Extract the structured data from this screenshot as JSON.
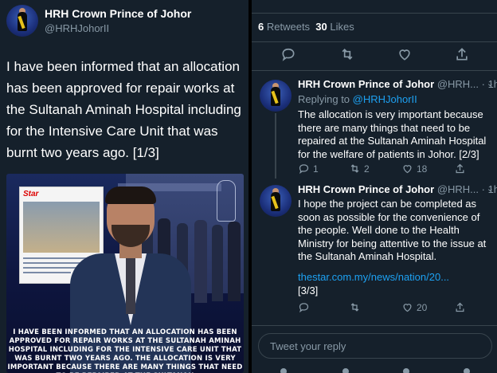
{
  "left": {
    "author_name": "HRH Crown Prince of Johor",
    "author_handle": "@HRHJohorII",
    "tweet_text": "I have been informed that an allocation has been approved for repair works at the Sultanah Aminah Hospital including for the Intensive Care Unit that was burnt two years ago. [1/3]",
    "image_caption": "I HAVE BEEN INFORMED THAT AN ALLOCATION HAS BEEN APPROVED FOR REPAIR WORKS AT THE SULTANAH AMINAH HOSPITAL INCLUDING FOR THE INTENSIVE CARE UNIT THAT WAS BURNT TWO YEARS AGO. THE ALLOCATION IS VERY IMPORTANT BECAUSE THERE ARE MANY THINGS THAT NEED TO BE REPAIRED AT THE SULTANAH",
    "news_logo": "Star"
  },
  "right": {
    "stats": {
      "retweets_count": "6",
      "retweets_label": "Retweets",
      "likes_count": "30",
      "likes_label": "Likes"
    },
    "replies": [
      {
        "name": "HRH Crown Prince of Johor",
        "handle": "@HRH...",
        "time": "· 1h",
        "replying_label": "Replying to",
        "replying_handle": "@HRHJohorII",
        "text": "The allocation is very important because there are many things that need to be repaired at the Sultanah Aminah Hospital for the welfare of patients in Johor. [2/3]",
        "reply_count": "1",
        "retweet_count": "2",
        "like_count": "18"
      },
      {
        "name": "HRH Crown Prince of Johor",
        "handle": "@HRH...",
        "time": "· 1h",
        "text": "I hope the project can be completed as soon as possible for the convenience of the people. Well done to the Health Ministry for being attentive to the issue at the Sultanah Aminah Hospital.",
        "link": "thestar.com.my/news/nation/20...",
        "suffix": "[3/3]",
        "reply_count": "",
        "retweet_count": "",
        "like_count": "20"
      }
    ],
    "composer_placeholder": "Tweet your reply"
  }
}
